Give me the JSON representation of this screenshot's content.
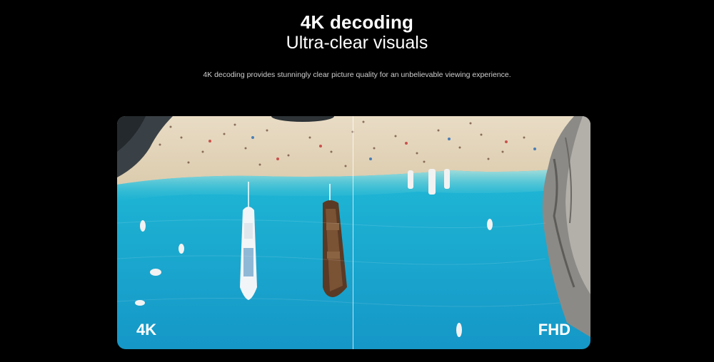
{
  "header": {
    "title": "4K decoding",
    "subtitle": "Ultra-clear visuals",
    "description": "4K decoding provides stunningly clear picture quality for an unbelievable viewing experience."
  },
  "comparison": {
    "left_label": "4K",
    "right_label": "FHD",
    "image_subject": "aerial beach photo with boats in turquoise water"
  },
  "colors": {
    "background": "#000000",
    "text": "#ffffff",
    "water": "#1fb3d1",
    "sand": "#e8d9c0"
  }
}
